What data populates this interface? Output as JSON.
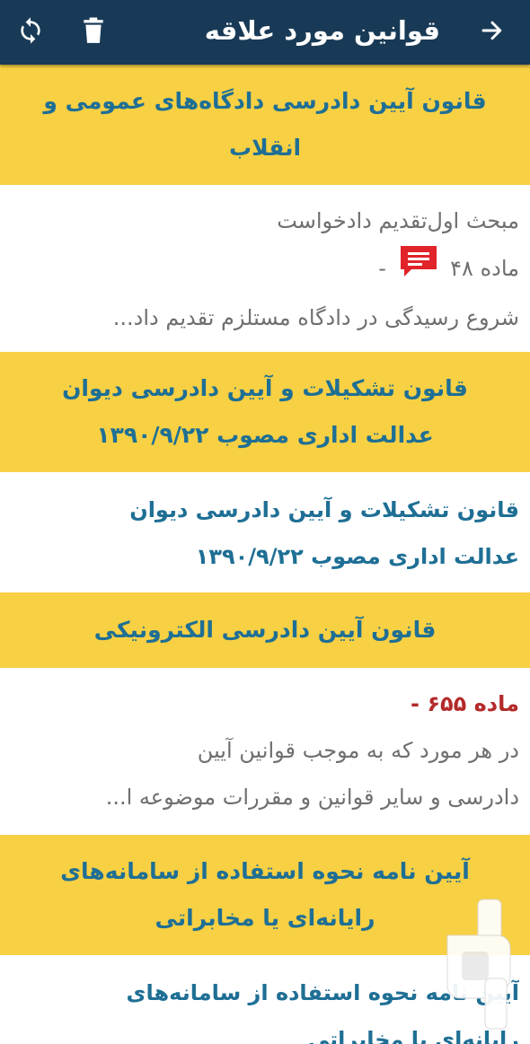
{
  "appbar": {
    "title": "قوانین مورد علاقه",
    "icons": {
      "back": "arrow-right-icon",
      "delete": "trash-icon",
      "sync": "sync-icon"
    }
  },
  "colors": {
    "appbar_bg": "#183a56",
    "header_bg": "#f8d043",
    "header_text": "#1f6f95",
    "article_red": "#b42a2a",
    "comment_icon": "#e0242a"
  },
  "sections": [
    {
      "header_lines": [
        "قانون آیین دادرسی دادگاه‌های عمومی و",
        "انقلاب"
      ],
      "card": {
        "subtitle": "مبحث اول‌تقدیم دادخواست",
        "article": "ماده ۴۸",
        "article_suffix": "-",
        "has_comment_icon": true,
        "excerpt_lines": [
          "شروع رسیدگی در دادگاه مستلزم تقدیم داد..."
        ]
      }
    },
    {
      "header_lines": [
        "قانون تشکیلات و آیین دادرسی دیوان",
        "عدالت اداری مصوب ۱۳۹۰/۹/۲۲"
      ],
      "card": {
        "title_lines": [
          "قانون تشکیلات و آیین دادرسی دیوان",
          "عدالت اداری مصوب ۱۳۹۰/۹/۲۲"
        ]
      }
    },
    {
      "header_lines": [
        "قانون آیین دادرسی الکترونیکی"
      ],
      "card": {
        "article": "ماده ۶۵۵ -",
        "excerpt_lines": [
          "در هر مورد که به موجب قوانین آیین",
          "دادرسی و سایر قوانین و مقررات موضوعه ا..."
        ]
      }
    },
    {
      "header_lines": [
        "آیین نامه نحوه استفاده از سامانه‌های",
        "رایانه‌ای یا مخابراتی"
      ],
      "card": {
        "title_lines": [
          "آیین نامه نحوه استفاده از سامانه‌های",
          "رایانه‌ای یا مخابراتی"
        ]
      }
    }
  ],
  "watermark": {
    "icon": "app-logo-watermark"
  }
}
